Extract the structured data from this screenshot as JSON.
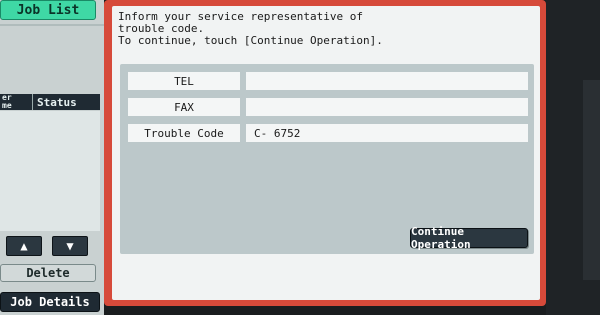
{
  "sidebar": {
    "job_list_label": "Job List",
    "list_header": {
      "col_a": "er\nme",
      "col_b": "Status"
    },
    "arrow_up": "▲",
    "arrow_down": "▼",
    "delete_label": "Delete",
    "job_details_label": "Job Details"
  },
  "dialog": {
    "message": "Inform your service representative of\ntrouble code.\nTo continue, touch [Continue Operation].",
    "rows": [
      {
        "label": "TEL",
        "value": ""
      },
      {
        "label": "FAX",
        "value": ""
      },
      {
        "label": "Trouble Code",
        "value": "C- 6752"
      }
    ],
    "continue_label": "Continue Operation"
  },
  "colors": {
    "frame": "#d64a3a",
    "job_list_accent": "#3fd8a5",
    "dark_button": "#2b3740"
  }
}
